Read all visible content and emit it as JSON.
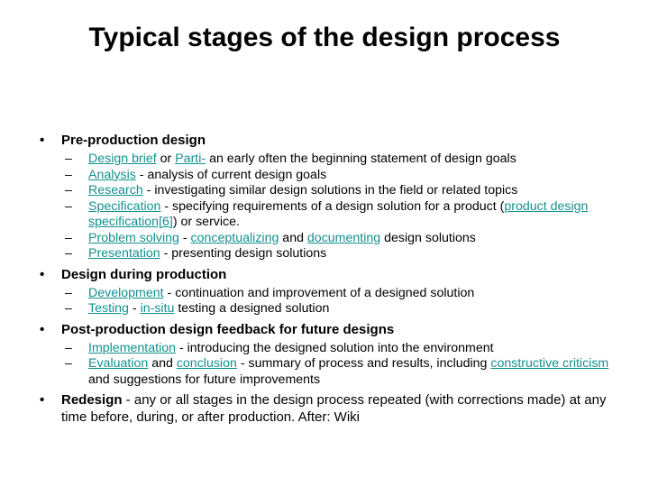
{
  "slide": {
    "title": "Typical stages of the design process",
    "bullet_marker_level1": "•",
    "bullet_marker_level2": "–",
    "link_color": "#12908f",
    "text_color": "#000000",
    "background_color": "#ffffff"
  },
  "sections": [
    {
      "heading": "Pre-production design",
      "items": [
        {
          "id": "design-brief",
          "runs": [
            {
              "text": "Design brief",
              "link": true
            },
            {
              "text": " or ",
              "link": false
            },
            {
              "text": "Parti-",
              "link": true
            },
            {
              "text": " an early often the beginning statement of design goals",
              "link": false
            }
          ]
        },
        {
          "id": "analysis",
          "runs": [
            {
              "text": "Analysis",
              "link": true
            },
            {
              "text": " - analysis of current design goals",
              "link": false
            }
          ]
        },
        {
          "id": "research",
          "runs": [
            {
              "text": "Research",
              "link": true
            },
            {
              "text": " - investigating similar design solutions in the field or related topics",
              "link": false
            }
          ]
        },
        {
          "id": "specification",
          "runs": [
            {
              "text": "Specification",
              "link": true
            },
            {
              "text": " - specifying requirements of a design solution for a product (",
              "link": false
            },
            {
              "text": "product design specification[6]",
              "link": true
            },
            {
              "text": ") or service.",
              "link": false
            }
          ]
        },
        {
          "id": "problem-solving",
          "runs": [
            {
              "text": "Problem solving",
              "link": true
            },
            {
              "text": " - ",
              "link": false
            },
            {
              "text": "conceptualizing",
              "link": true
            },
            {
              "text": " and ",
              "link": false
            },
            {
              "text": "documenting",
              "link": true
            },
            {
              "text": " design solutions",
              "link": false
            }
          ]
        },
        {
          "id": "presentation",
          "runs": [
            {
              "text": "Presentation",
              "link": true
            },
            {
              "text": " - presenting design solutions",
              "link": false
            }
          ]
        }
      ]
    },
    {
      "heading": "Design during production",
      "items": [
        {
          "id": "development",
          "runs": [
            {
              "text": "Development",
              "link": true
            },
            {
              "text": " - continuation and improvement of a designed solution",
              "link": false
            }
          ]
        },
        {
          "id": "testing",
          "runs": [
            {
              "text": "Testing",
              "link": true
            },
            {
              "text": " - ",
              "link": false
            },
            {
              "text": "in-situ",
              "link": true
            },
            {
              "text": " testing a designed solution",
              "link": false
            }
          ]
        }
      ]
    },
    {
      "heading": "Post-production design feedback for future designs",
      "items": [
        {
          "id": "implementation",
          "runs": [
            {
              "text": "Implementation",
              "link": true
            },
            {
              "text": " - introducing the designed solution into the environment",
              "link": false
            }
          ]
        },
        {
          "id": "evaluation",
          "runs": [
            {
              "text": "Evaluation",
              "link": true
            },
            {
              "text": " and ",
              "link": false
            },
            {
              "text": "conclusion",
              "link": true
            },
            {
              "text": " - summary of process and results, including ",
              "link": false
            },
            {
              "text": "constructive criticism",
              "link": true
            },
            {
              "text": " and suggestions for future improvements",
              "link": false
            }
          ]
        }
      ]
    },
    {
      "heading_runs": [
        {
          "text": "Redesign",
          "bold": true
        },
        {
          "text": " - any or all stages in the design process repeated (with corrections made) at any time before, during, or after production. After: Wiki",
          "bold": false
        }
      ],
      "items": []
    }
  ]
}
